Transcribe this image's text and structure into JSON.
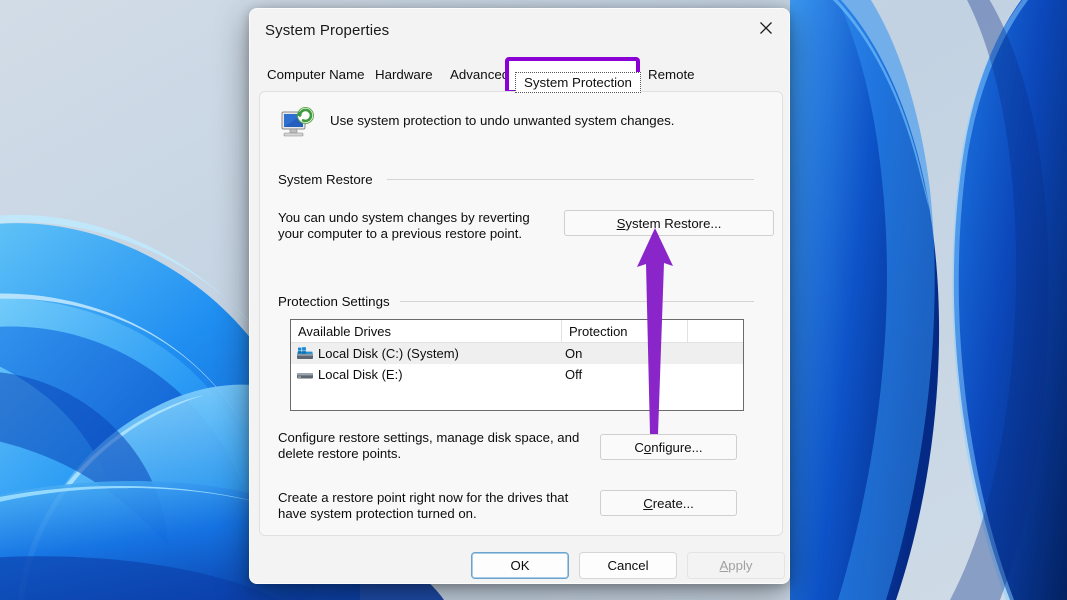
{
  "window": {
    "title": "System Properties",
    "close_icon": "close-icon"
  },
  "tabs": [
    {
      "label": "Computer Name",
      "selected": false
    },
    {
      "label": "Hardware",
      "selected": false
    },
    {
      "label": "Advanced",
      "selected": false
    },
    {
      "label": "System Protection",
      "selected": true
    },
    {
      "label": "Remote",
      "selected": false
    }
  ],
  "header": {
    "icon": "system-protection-icon",
    "description": "Use system protection to undo unwanted system changes."
  },
  "system_restore": {
    "group_label": "System Restore",
    "description": "You can undo system changes by reverting\nyour computer to a previous restore point.",
    "button_label": "System Restore...",
    "button_accel": "S"
  },
  "protection_settings": {
    "group_label": "Protection Settings",
    "columns": [
      "Available Drives",
      "Protection"
    ],
    "rows": [
      {
        "name": "Local Disk (C:) (System)",
        "protection": "On",
        "selected": true,
        "icon": "system-drive-icon"
      },
      {
        "name": "Local Disk (E:)",
        "protection": "Off",
        "selected": false,
        "icon": "drive-icon"
      }
    ],
    "configure": {
      "description": "Configure restore settings, manage disk space, and\ndelete restore points.",
      "button_label": "Configure...",
      "button_accel": "o"
    },
    "create": {
      "description": "Create a restore point right now for the drives that\nhave system protection turned on.",
      "button_label": "Create...",
      "button_accel": "C"
    }
  },
  "footer": {
    "ok_label": "OK",
    "cancel_label": "Cancel",
    "apply_label": "Apply",
    "apply_accel": "A",
    "apply_disabled": true
  },
  "annotation": {
    "highlight_color": "#8A00D4",
    "arrow_color": "#8A26C9",
    "highlight_target": "System Protection",
    "arrow_target": "System Restore..."
  }
}
